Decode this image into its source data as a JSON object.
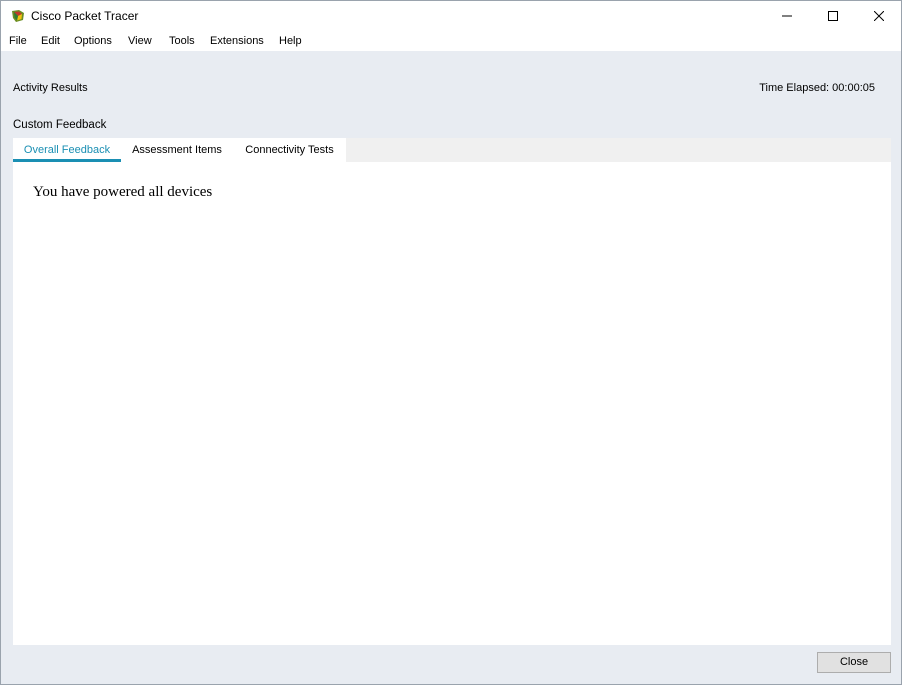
{
  "window": {
    "title": "Cisco Packet Tracer",
    "icon": "packet-tracer-icon"
  },
  "menu": {
    "items": [
      "File",
      "Edit",
      "Options",
      "View",
      "Tools",
      "Extensions",
      "Help"
    ]
  },
  "header": {
    "activity_results": "Activity Results",
    "time_elapsed": "Time Elapsed: 00:00:05"
  },
  "feedback": {
    "section_title": "Custom Feedback",
    "tabs": [
      {
        "label": "Overall Feedback",
        "active": true
      },
      {
        "label": "Assessment Items",
        "active": false
      },
      {
        "label": "Connectivity Tests",
        "active": false
      }
    ],
    "message": "You have powered all devices"
  },
  "footer": {
    "close_label": "Close"
  },
  "colors": {
    "accent": "#1a8fb3",
    "background": "#e8ecf2"
  }
}
